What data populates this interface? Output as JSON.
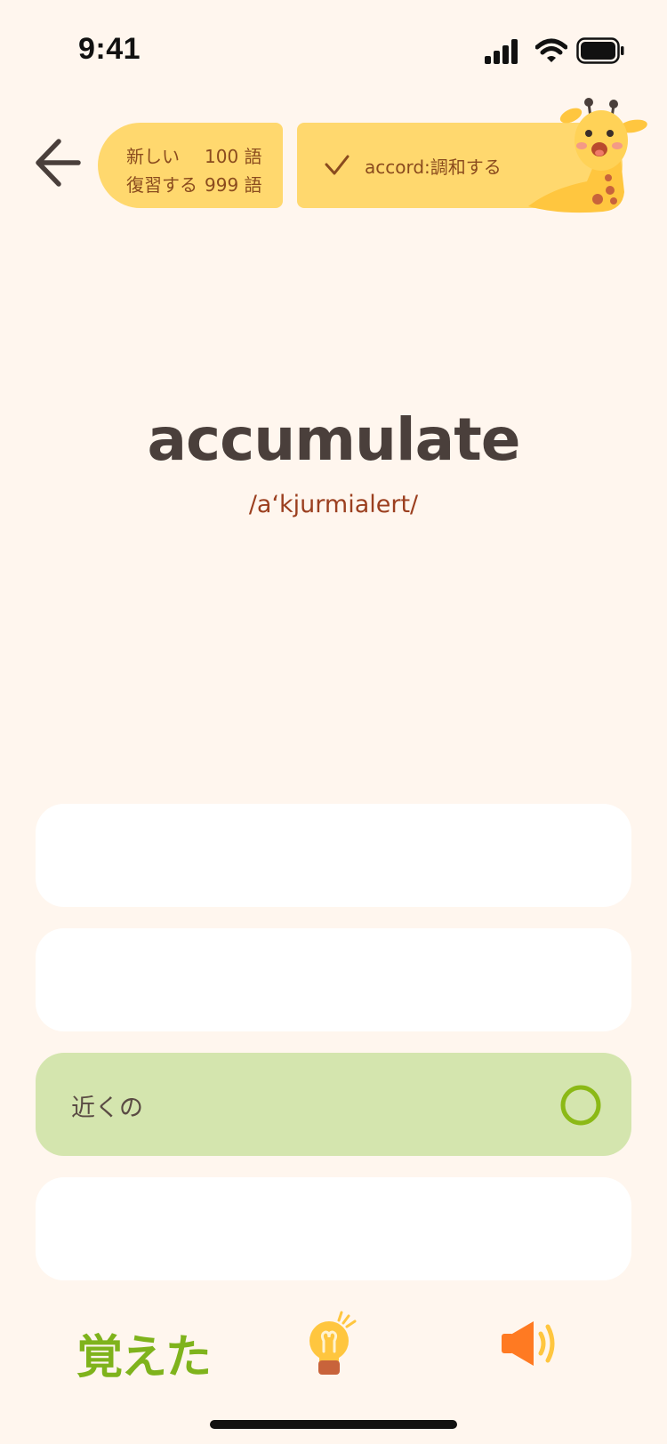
{
  "status_bar": {
    "time": "9:41"
  },
  "header": {
    "stats": {
      "new_label": "新しい",
      "new_count": "100 語",
      "review_label": "復習する",
      "review_count": "999 語"
    },
    "last_word": "accord:調和する"
  },
  "card": {
    "word": "accumulate",
    "phonetic": "/aʻkjurmialert/"
  },
  "options": [
    {
      "label": ""
    },
    {
      "label": ""
    },
    {
      "label": "近くの",
      "state": "correct"
    },
    {
      "label": ""
    }
  ],
  "bottom": {
    "memorized_label": "覚えた"
  },
  "colors": {
    "background": "#fff6ee",
    "pill": "#ffd86e",
    "pill_text": "#8a4b1e",
    "correct_option": "#d4e5ae",
    "correct_mark": "#8bb916",
    "memorized": "#7fb31c",
    "speaker": "#ff7a22"
  },
  "icons": [
    "back-arrow-icon",
    "check-icon",
    "giraffe-mascot",
    "lightbulb-hint-icon",
    "speaker-icon",
    "signal-icon",
    "wifi-icon",
    "battery-icon"
  ]
}
